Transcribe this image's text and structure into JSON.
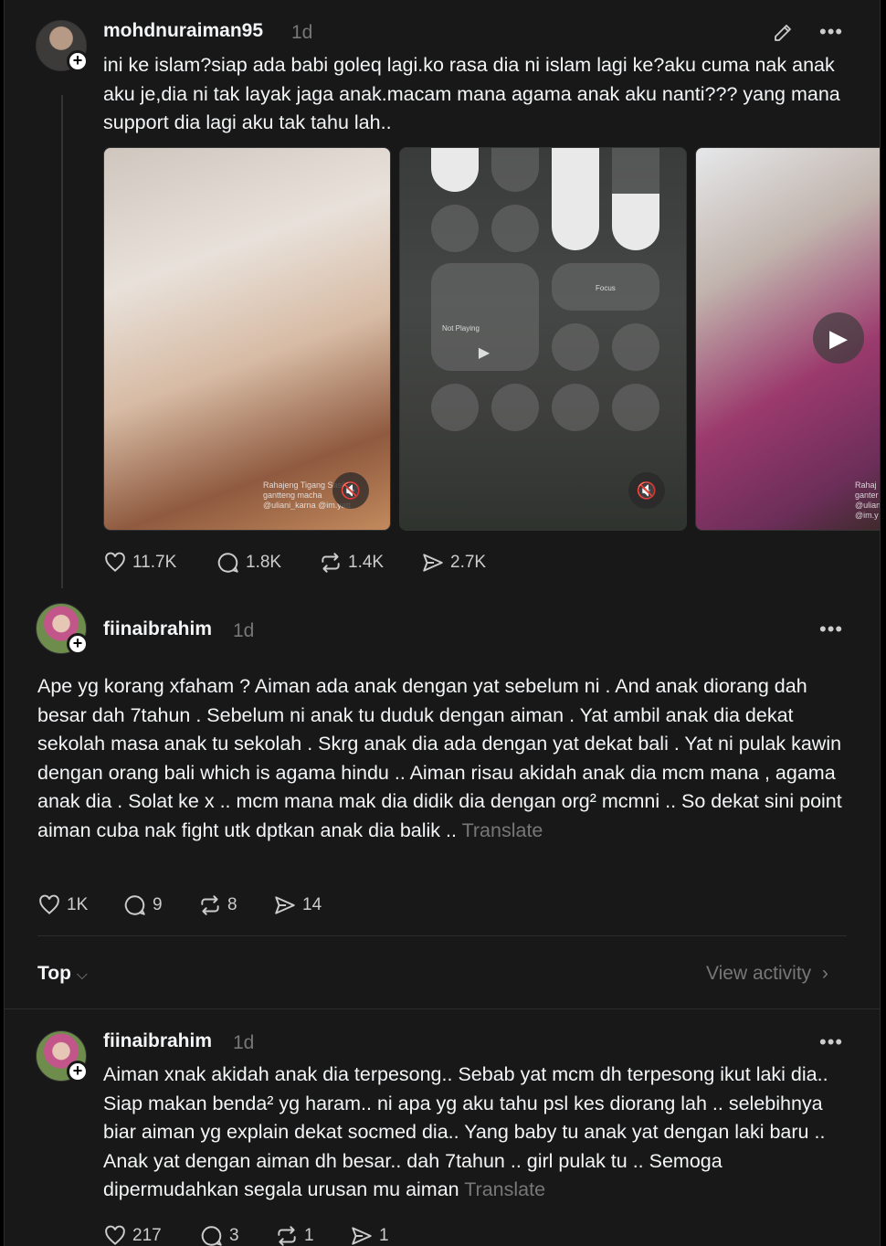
{
  "post": {
    "username": "mohdnuraiman95",
    "time": "1d",
    "text": "ini ke islam?siap ada babi goleq lagi.ko rasa dia ni islam lagi ke?aku cuma nak anak aku je,dia ni tak layak jaga anak.macam mana agama anak aku nanti??? yang mana support dia lagi aku tak tahu lah..",
    "media_caption": "Rahajeng Tigang Sasih ... gantteng macha @uliani_karna @im.yatt",
    "media3_caption": "Rahaj ganter @ulian @im.y",
    "control_center": {
      "now_playing": "Not Playing",
      "focus": "Focus"
    },
    "stats": {
      "likes": "11.7K",
      "comments": "1.8K",
      "reposts": "1.4K",
      "shares": "2.7K"
    }
  },
  "reply1": {
    "username": "fiinaibrahim",
    "time": "1d",
    "text": "Ape yg korang xfaham ? Aiman ada anak dengan yat sebelum ni . And anak diorang dah besar dah 7tahun . Sebelum ni anak tu duduk dengan aiman . Yat ambil anak dia dekat sekolah masa anak tu sekolah . Skrg anak dia ada dengan yat dekat bali . Yat ni pulak kawin dengan orang bali which is agama hindu .. Aiman risau akidah anak dia mcm mana , agama anak dia . Solat ke x .. mcm mana mak dia didik dia dengan org² mcmni .. So dekat sini point aiman cuba nak fight utk dptkan anak dia balik ..",
    "translate": "Translate",
    "stats": {
      "likes": "1K",
      "comments": "9",
      "reposts": "8",
      "shares": "14"
    }
  },
  "sort": {
    "label": "Top",
    "view_activity": "View activity"
  },
  "reply2": {
    "username": "fiinaibrahim",
    "time": "1d",
    "text": "Aiman xnak akidah anak dia terpesong.. Sebab yat mcm dh terpesong ikut laki dia.. Siap makan benda² yg haram.. ni apa yg aku tahu psl kes diorang lah .. selebihnya biar aiman yg explain dekat socmed dia.. Yang baby tu anak yat dengan laki baru .. Anak yat dengan aiman dh besar.. dah 7tahun .. girl pulak tu .. Semoga dipermudahkan segala urusan mu aiman",
    "translate": "Translate",
    "stats": {
      "likes": "217",
      "comments": "3",
      "reposts": "1",
      "shares": "1"
    }
  }
}
